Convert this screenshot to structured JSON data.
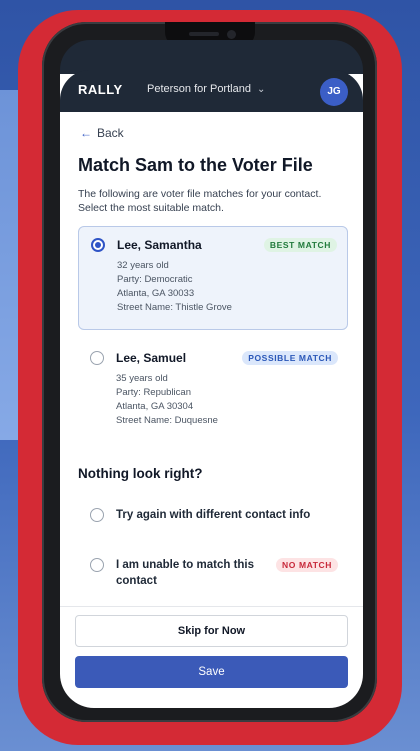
{
  "header": {
    "brand": "RALLY",
    "campaign": "Peterson for Portland",
    "campaign_chevron": "chevron-down-icon",
    "avatar_initials": "JG"
  },
  "nav": {
    "back_label": "Back",
    "back_icon": "arrow-left-icon"
  },
  "page": {
    "title": "Match Sam to the Voter File",
    "subtitle": "The following are voter file matches for your contact. Select the most suitable match."
  },
  "matches": [
    {
      "name": "Lee, Samantha",
      "badge": "BEST MATCH",
      "age": "32 years old",
      "party": "Party: Democratic",
      "location": "Atlanta, GA 30033",
      "street": "Street Name: Thistle Grove",
      "selected": true
    },
    {
      "name": "Lee, Samuel",
      "badge": "POSSIBLE MATCH",
      "age": "35 years old",
      "party": "Party: Republican",
      "location": "Atlanta, GA 30304",
      "street": "Street Name: Duquesne",
      "selected": false
    }
  ],
  "fallback": {
    "heading": "Nothing look right?",
    "option_retry": "Try again with different contact info",
    "option_unable": "I am unable to match this contact",
    "option_unable_badge": "NO MATCH"
  },
  "actions": {
    "skip_label": "Skip for Now",
    "save_label": "Save"
  },
  "colors": {
    "primary": "#3b5ab8",
    "topbar": "#1f2937",
    "frame_red": "#d42a35",
    "best_green": "#217a3c",
    "possible_blue": "#2a57b8",
    "nomatch_red": "#c7283a"
  }
}
